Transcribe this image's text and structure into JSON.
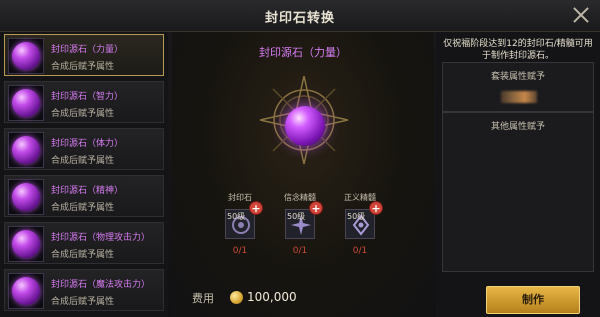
{
  "window": {
    "title": "封印石转换"
  },
  "sidebar": {
    "items": [
      {
        "name": "封印源石（力量）",
        "desc": "合成后赋予属性",
        "selected": true
      },
      {
        "name": "封印源石（智力）",
        "desc": "合成后赋予属性",
        "selected": false
      },
      {
        "name": "封印源石（体力）",
        "desc": "合成后赋予属性",
        "selected": false
      },
      {
        "name": "封印源石（精神）",
        "desc": "合成后赋予属性",
        "selected": false
      },
      {
        "name": "封印源石（物理攻击力）",
        "desc": "合成后赋予属性",
        "selected": false
      },
      {
        "name": "封印源石（魔法攻击力）",
        "desc": "合成后赋予属性",
        "selected": false
      }
    ]
  },
  "center": {
    "stone_title": "封印源石（力量）",
    "materials": [
      {
        "label": "封印石",
        "level": "50级",
        "count": "0/1"
      },
      {
        "label": "信念精髓",
        "level": "50级",
        "count": "0/1"
      },
      {
        "label": "正义精髓",
        "level": "50级",
        "count": "0/1"
      }
    ],
    "fee_label": "费用",
    "fee_value": "100,000"
  },
  "right": {
    "notice": "仅祝福阶段达到12的封印石/精髓可用于制作封印源石。",
    "set_attr_header": "套装属性赋予",
    "other_attr_header": "其他属性赋予"
  },
  "actions": {
    "make_label": "制作"
  },
  "colors": {
    "accent_purple": "#d77cf2",
    "gold": "#d7a732",
    "count_red": "#c84a3a"
  },
  "icons": [
    "close-icon",
    "stone-orb-icon",
    "coin-icon",
    "plus-icon",
    "emblem-icon"
  ]
}
